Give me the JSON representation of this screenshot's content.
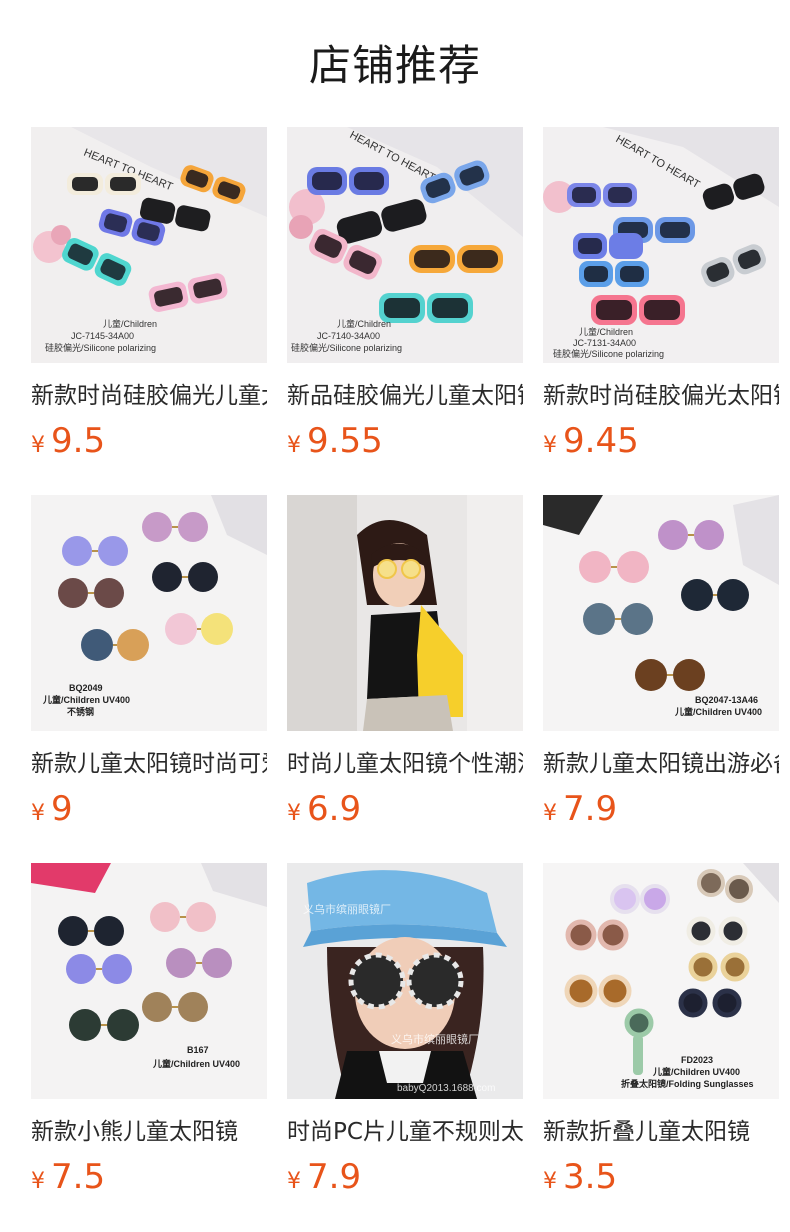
{
  "header": {
    "title": "店铺推荐"
  },
  "products": [
    {
      "name": "新款时尚硅胶偏光儿童太阳镜",
      "currency": "¥",
      "price": "9.5",
      "image_text": [
        "儿童/Children",
        "JC-7145-34A00",
        "硅胶偏光/Silicone polarizing",
        "HEART TO HEART"
      ]
    },
    {
      "name": "新品硅胶偏光儿童太阳镜",
      "currency": "¥",
      "price": "9.55",
      "image_text": [
        "儿童/Children",
        "JC-7140-34A00",
        "硅胶偏光/Silicone polarizing",
        "HEART TO HEART"
      ]
    },
    {
      "name": "新款时尚硅胶偏光太阳镜",
      "currency": "¥",
      "price": "9.45",
      "image_text": [
        "儿童/Children",
        "JC-7131-34A00",
        "硅胶偏光/Silicone polarizing",
        "HEART TO HEART"
      ]
    },
    {
      "name": "新款儿童太阳镜时尚可爱",
      "currency": "¥",
      "price": "9",
      "image_text": [
        "BQ2049",
        "儿童/Children UV400",
        "不锈钢"
      ]
    },
    {
      "name": "时尚儿童太阳镜个性潮流",
      "currency": "¥",
      "price": "6.9",
      "image_text": []
    },
    {
      "name": "新款儿童太阳镜出游必备",
      "currency": "¥",
      "price": "7.9",
      "image_text": [
        "BQ2047-13A46",
        "儿童/Children UV400"
      ]
    },
    {
      "name": "新款小熊儿童太阳镜",
      "currency": "¥",
      "price": "7.5",
      "image_text": [
        "B167",
        "儿童/Children UV400"
      ]
    },
    {
      "name": "时尚PC片儿童不规则太阳镜",
      "currency": "¥",
      "price": "7.9",
      "image_text": [
        "义乌市缤丽眼镜厂",
        "babyQ2013.1688.com"
      ]
    },
    {
      "name": "新款折叠儿童太阳镜",
      "currency": "¥",
      "price": "3.5",
      "image_text": [
        "FD2023",
        "儿童/Children UV400",
        "折叠太阳镜/Folding Sunglasses"
      ]
    }
  ],
  "colors": {
    "price": "#e8541a",
    "title": "#1a1a1a"
  }
}
